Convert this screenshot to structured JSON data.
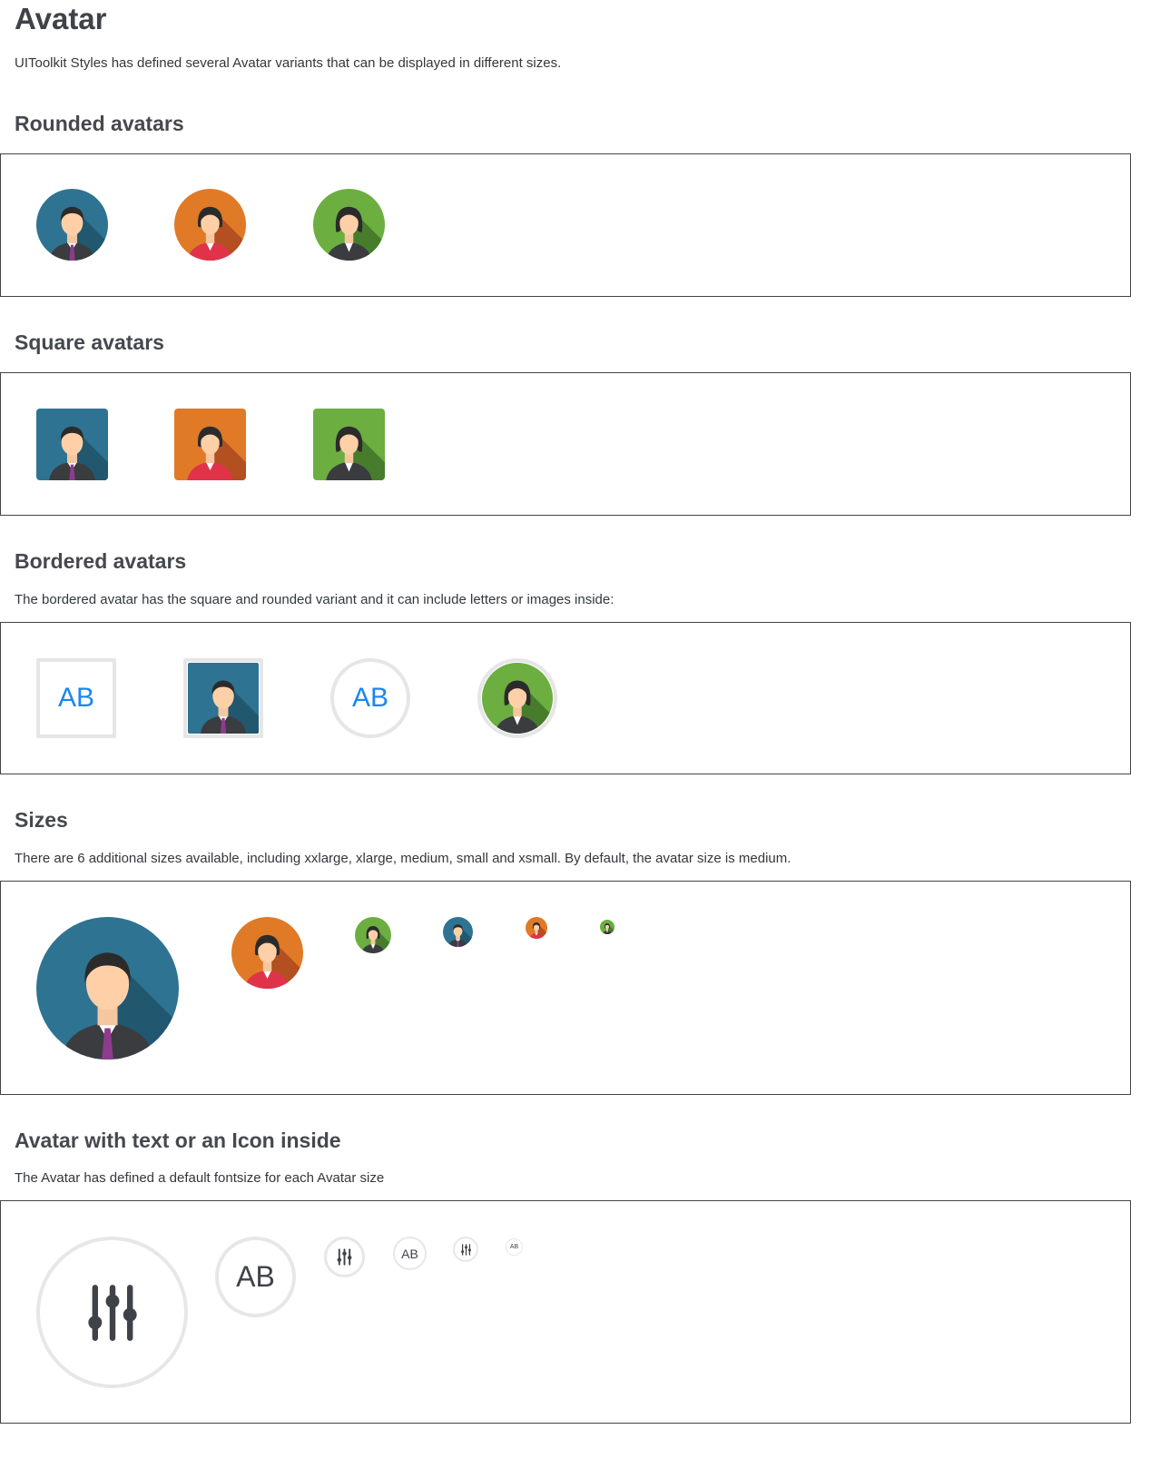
{
  "page": {
    "title": "Avatar",
    "intro": "UIToolkit Styles has defined several Avatar variants that can be displayed in different sizes."
  },
  "sections": {
    "rounded": {
      "heading": "Rounded avatars"
    },
    "square": {
      "heading": "Square avatars"
    },
    "bordered": {
      "heading": "Bordered avatars",
      "description": "The bordered avatar has the square and rounded variant and it can include letters or images inside:",
      "initials": "AB"
    },
    "sizes": {
      "heading": "Sizes",
      "description": "There are 6 additional sizes available, including xxlarge, xlarge, medium, small and xsmall. By default, the avatar size is medium."
    },
    "text_icon": {
      "heading": "Avatar with text or an Icon inside",
      "description": "The Avatar has defined a default fontsize for each Avatar size",
      "initials": "AB"
    }
  },
  "colors": {
    "blue_avatar": "#2e6f8e",
    "orange_avatar": "#e07a26",
    "green_avatar": "#6aab3f",
    "initials_blue": "#1a86f2",
    "border_gray": "#e6e6e6"
  },
  "icons": {
    "people": [
      "man-avatar-icon",
      "woman-avatar-icon"
    ],
    "sliders": "sliders-icon"
  }
}
